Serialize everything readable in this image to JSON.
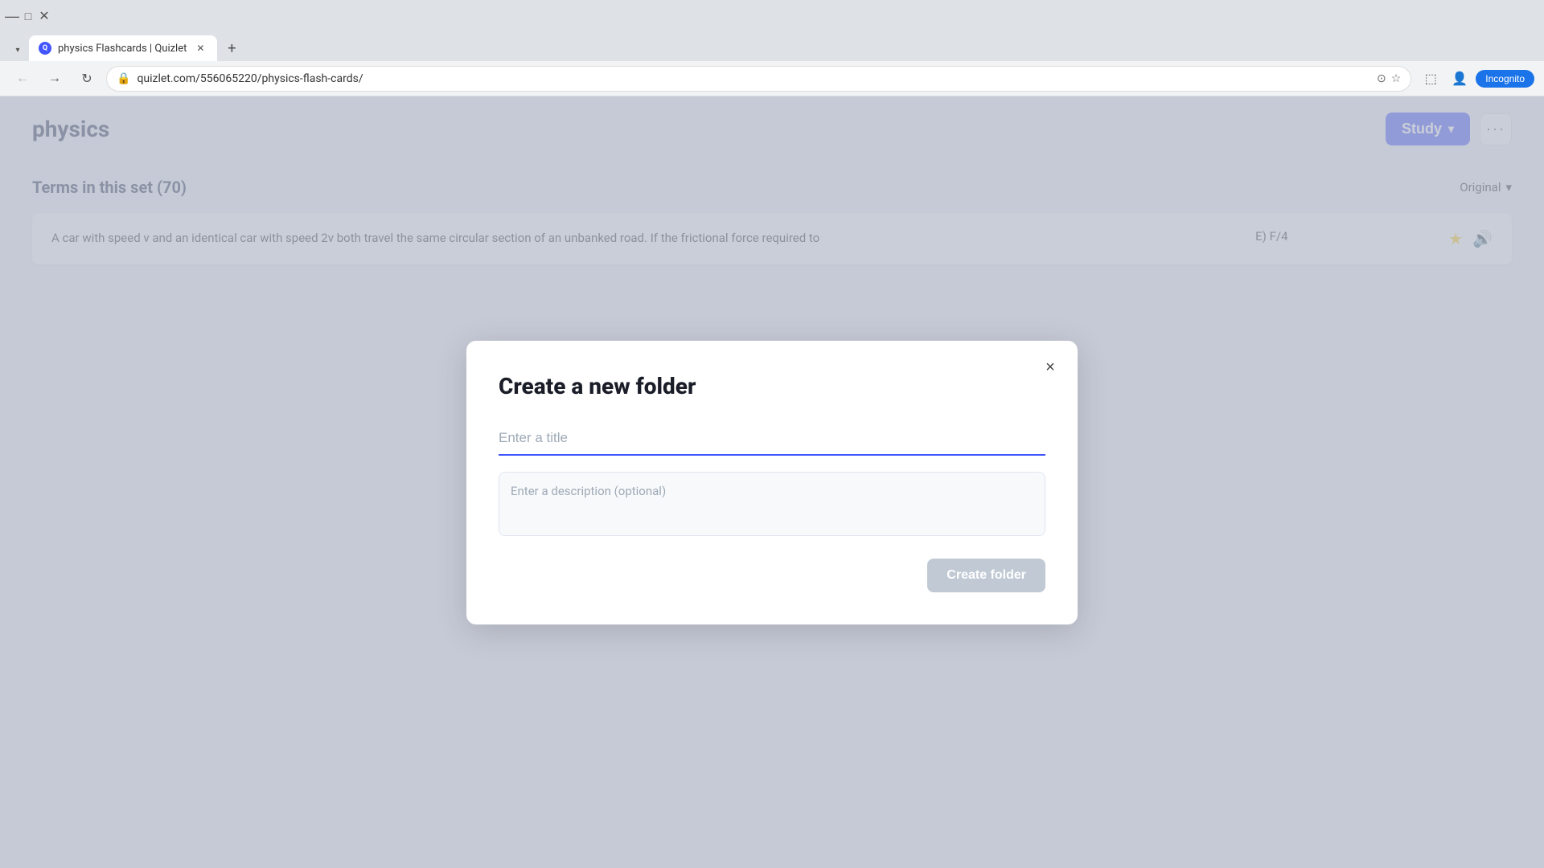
{
  "browser": {
    "tab_title": "physics Flashcards | Quizlet",
    "tab_favicon_letter": "Q",
    "url": "quizlet.com/556065220/physics-flash-cards/",
    "incognito_label": "Incognito"
  },
  "page": {
    "title": "physics",
    "study_button_label": "Study",
    "more_button_label": "···"
  },
  "modal": {
    "title": "Create a new folder",
    "title_placeholder": "Enter a title",
    "description_placeholder": "Enter a description (optional)",
    "create_button_label": "Create folder",
    "close_icon": "×"
  },
  "terms_section": {
    "heading": "Terms in this set (70)",
    "sort_label": "Original",
    "term1": {
      "text": "A car with speed v and an identical car with speed 2v both travel the same circular section of an unbanked road. If the frictional force required to",
      "definition": "E) F/4"
    }
  }
}
